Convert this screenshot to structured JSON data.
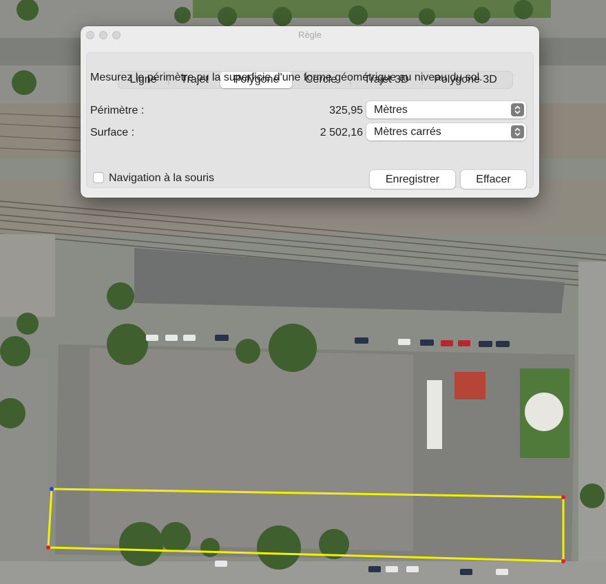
{
  "window": {
    "title": "Règle"
  },
  "tabs": [
    {
      "label": "Ligne",
      "active": false
    },
    {
      "label": "Trajet",
      "active": false
    },
    {
      "label": "Polygone",
      "active": true
    },
    {
      "label": "Cercle",
      "active": false
    },
    {
      "label": "Trajet 3D",
      "active": false
    },
    {
      "label": "Polygone 3D",
      "active": false
    }
  ],
  "description": "Mesurez le périmètre ou la superficie d'une forme géométrique au niveau du sol.",
  "measurements": {
    "perimeter": {
      "label": "Périmètre :",
      "value": "325,95",
      "unit": "Mètres"
    },
    "area": {
      "label": "Surface :",
      "value": "2 502,16",
      "unit": "Mètres carrés"
    }
  },
  "mouse_navigation": {
    "label": "Navigation à la souris",
    "checked": false
  },
  "buttons": {
    "save": "Enregistrer",
    "clear": "Effacer"
  },
  "colors": {
    "polygon_outline": "#f2f200",
    "vertex": "#e02020",
    "first_vertex": "#2040e0"
  },
  "icons": {
    "select_arrows": "chevron-up-down-icon"
  }
}
